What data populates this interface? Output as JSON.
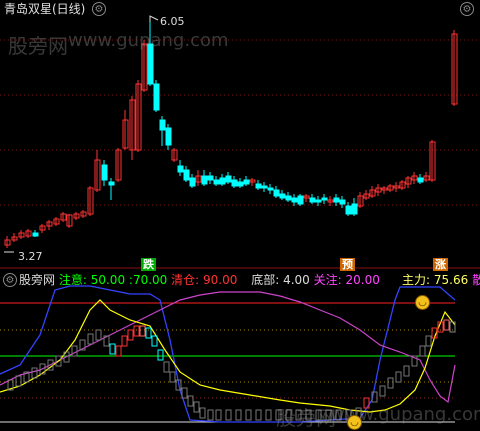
{
  "header": {
    "title": "青岛双星(日线)",
    "price_high": "6.05",
    "price_low": "3.27"
  },
  "watermark": {
    "site_cn": "股旁网",
    "site_url": "www.gupang.com"
  },
  "signals": {
    "fall": "跌",
    "warn": "预",
    "surge": "涨"
  },
  "indicator": {
    "name": "股旁网",
    "attention_label": "注意",
    "attention_value": "50.00",
    "level_value": ":70.00",
    "clear_label": "清仓",
    "clear_value": "90.00",
    "bottom_label": "底部",
    "bottom_value": "4.00",
    "focus_label": "关注",
    "focus_value": "20.00",
    "main_label": "主力",
    "main_value": "75.66",
    "tail_label": "散"
  },
  "colors": {
    "up": "#ff3333",
    "down": "#00ffff",
    "green": "#00ff00",
    "yellow": "#ffff00",
    "magenta": "#cc44cc",
    "blue": "#3344ff",
    "red_line": "#ff2222",
    "tag_bg": "#cc6600"
  },
  "icons": {
    "gear": "gear-icon",
    "smile": "smile-icon",
    "settings": "settings-icon"
  }
}
